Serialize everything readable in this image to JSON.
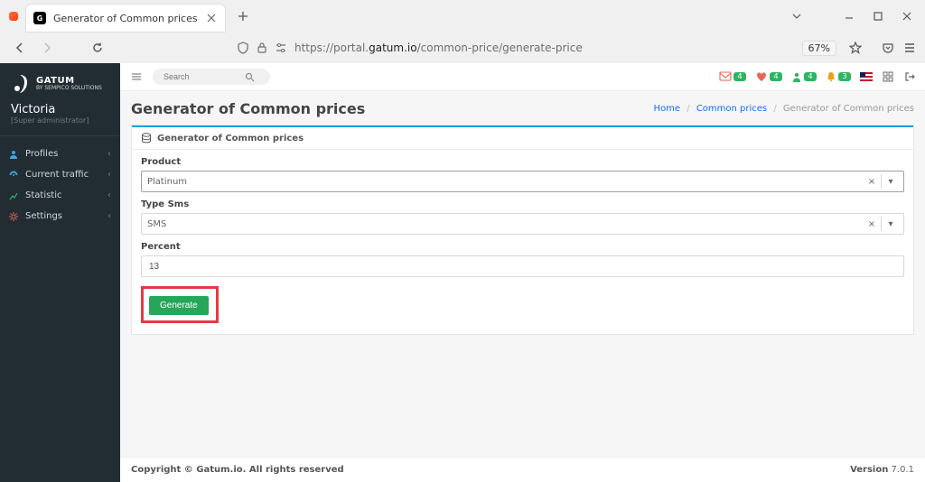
{
  "browser": {
    "tab_title": "Generator of Common prices",
    "url_prefix": "https://portal.",
    "url_domain": "gatum.io",
    "url_path": "/common-price/generate-price",
    "zoom": "67%"
  },
  "brand": {
    "name": "GATUM",
    "subtitle": "BY SEMPICO SOLUTIONS"
  },
  "user": {
    "name": "Victoria",
    "role": "[Super administrator]"
  },
  "sidebar": {
    "items": [
      {
        "label": "Profiles",
        "icon_color": "#3da6dd"
      },
      {
        "label": "Current traffic",
        "icon_color": "#3da6dd"
      },
      {
        "label": "Statistic",
        "icon_color": "#2db563"
      },
      {
        "label": "Settings",
        "icon_color": "#e86558"
      }
    ]
  },
  "topbar": {
    "search_placeholder": "Search",
    "badges": [
      {
        "name": "badge-a",
        "icon_color": "#e86558",
        "count": "4"
      },
      {
        "name": "badge-b",
        "icon_color": "#e86558",
        "count": "4"
      },
      {
        "name": "badge-c",
        "icon_color": "#2db563",
        "count": "4"
      },
      {
        "name": "badge-d",
        "icon_color": "#f39c12",
        "count": "3"
      }
    ]
  },
  "page": {
    "title": "Generator of Common prices",
    "breadcrumbs": {
      "home": "Home",
      "parent": "Common prices",
      "current": "Generator of Common prices"
    },
    "panel_title": "Generator of Common prices",
    "form": {
      "product_label": "Product",
      "product_value": "Platinum",
      "type_label": "Type Sms",
      "type_value": "SMS",
      "percent_label": "Percent",
      "percent_value": "13",
      "generate": "Generate"
    }
  },
  "footer": {
    "copyright": "Copyright © Gatum.io. All rights reserved",
    "version_label": "Version",
    "version": "7.0.1"
  }
}
